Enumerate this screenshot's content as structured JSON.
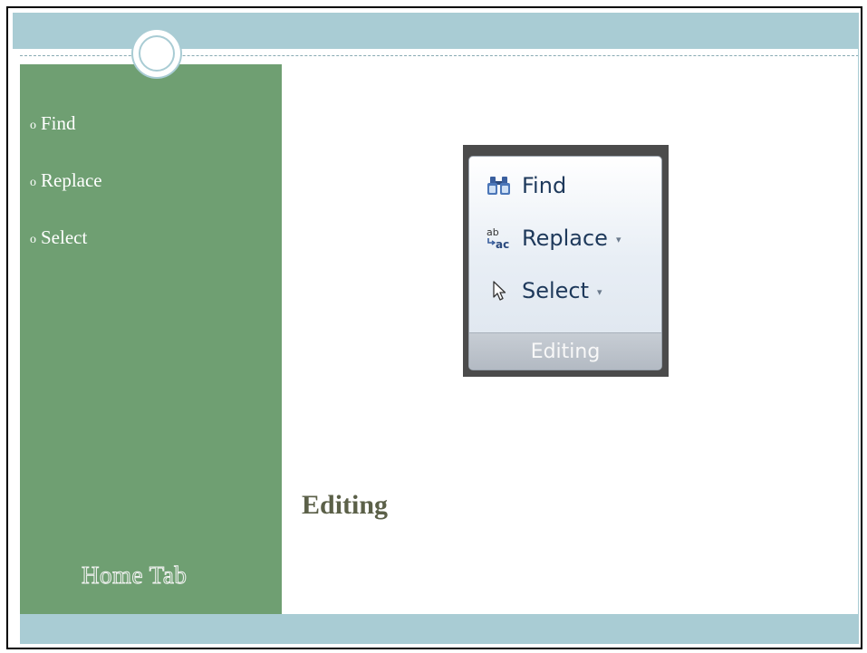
{
  "sidebar": {
    "bullet_marker": "o",
    "items": [
      {
        "label": "Find"
      },
      {
        "label": "Replace"
      },
      {
        "label": "Select"
      }
    ],
    "footer_label": "Home Tab"
  },
  "ribbon": {
    "items": [
      {
        "label": "Find",
        "icon": "binoculars-icon",
        "has_dropdown": false
      },
      {
        "label": "Replace",
        "icon": "replace-icon",
        "has_dropdown": true
      },
      {
        "label": "Select",
        "icon": "cursor-arrow-icon",
        "has_dropdown": true
      }
    ],
    "dropdown_glyph": "▾",
    "group_label": "Editing"
  },
  "slide": {
    "title": "Editing"
  },
  "colors": {
    "accent_band": "#a9ccd4",
    "sidebar_green": "#6f9f72",
    "title_text": "#5b6048",
    "ribbon_text": "#1e395b"
  }
}
